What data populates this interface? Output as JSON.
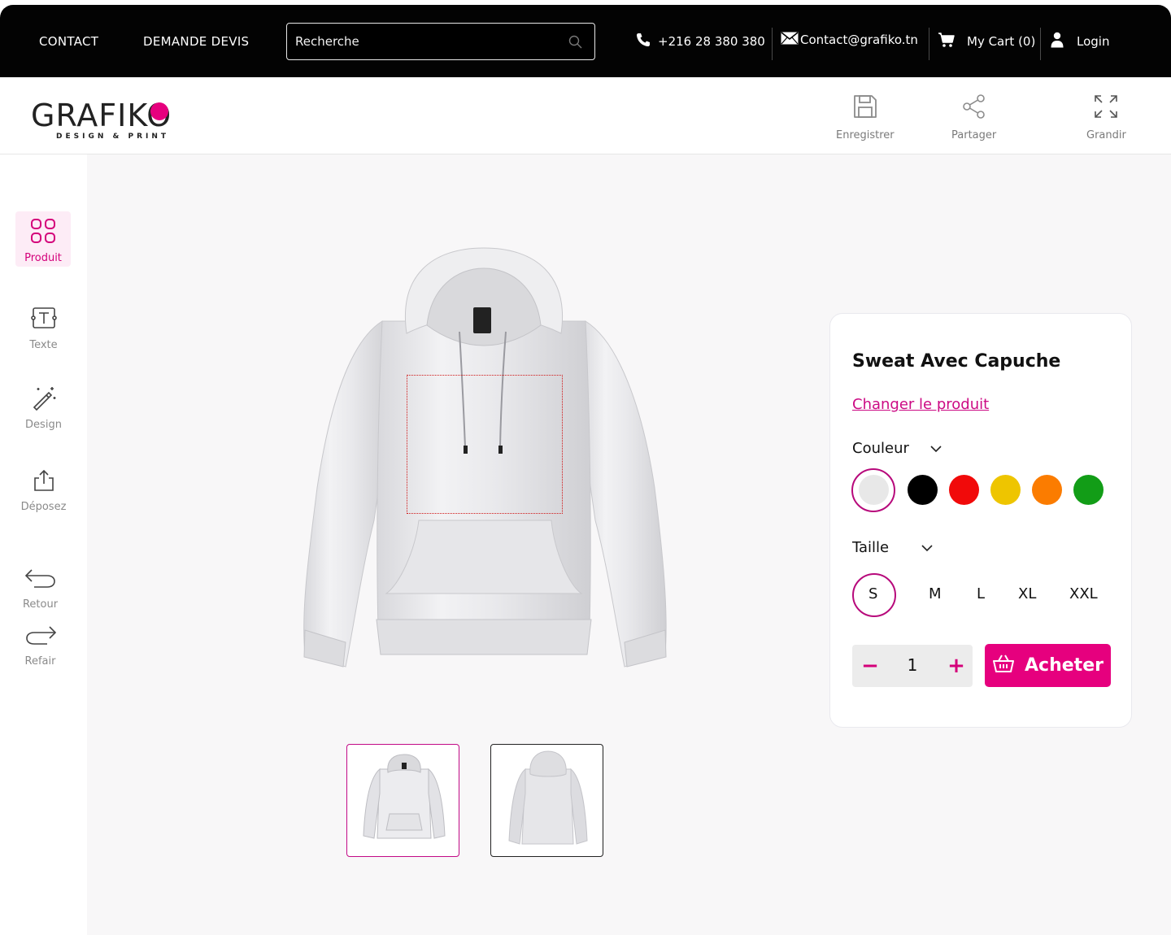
{
  "topbar": {
    "nav": [
      "CONTACT",
      "DEMANDE DEVIS"
    ],
    "search_placeholder": "Recherche",
    "phone": "+216 28 380 380",
    "email": "Contact@grafiko.tn",
    "cart": "My Cart (0)",
    "login": "Login"
  },
  "logo": {
    "wordmark": "GRAFIKO",
    "tagline": "DESIGN & PRINT",
    "accent": "#e6007e"
  },
  "toolbar": {
    "save": "Enregistrer",
    "share": "Partager",
    "expand": "Grandir"
  },
  "sidebar": {
    "items": [
      {
        "label": "Produit",
        "icon": "grid-icon",
        "active": true
      },
      {
        "label": "Texte",
        "icon": "text-icon"
      },
      {
        "label": "Design",
        "icon": "magic-wand-icon"
      },
      {
        "label": "Déposez",
        "icon": "upload-icon"
      },
      {
        "label": "Retour",
        "icon": "undo-icon"
      },
      {
        "label": "Refair",
        "icon": "redo-icon"
      }
    ]
  },
  "product": {
    "title": "Sweat Avec Capuche",
    "change_link": "Changer le produit",
    "color_label": "Couleur",
    "colors": [
      "#e8e8e8",
      "#000000",
      "#f10a0a",
      "#eec500",
      "#fb7c00",
      "#129d17"
    ],
    "selected_color": 0,
    "size_label": "Taille",
    "sizes": [
      "S",
      "M",
      "L",
      "XL",
      "XXL"
    ],
    "selected_size": "S",
    "quantity": "1",
    "minus": "−",
    "plus": "+",
    "buy_label": "Acheter"
  },
  "thumbnails": [
    "hoodie-front",
    "hoodie-back"
  ],
  "theme": {
    "brand": "#e6007e",
    "topbar_bg": "#030303",
    "canvas_bg": "#f8f7f8"
  }
}
